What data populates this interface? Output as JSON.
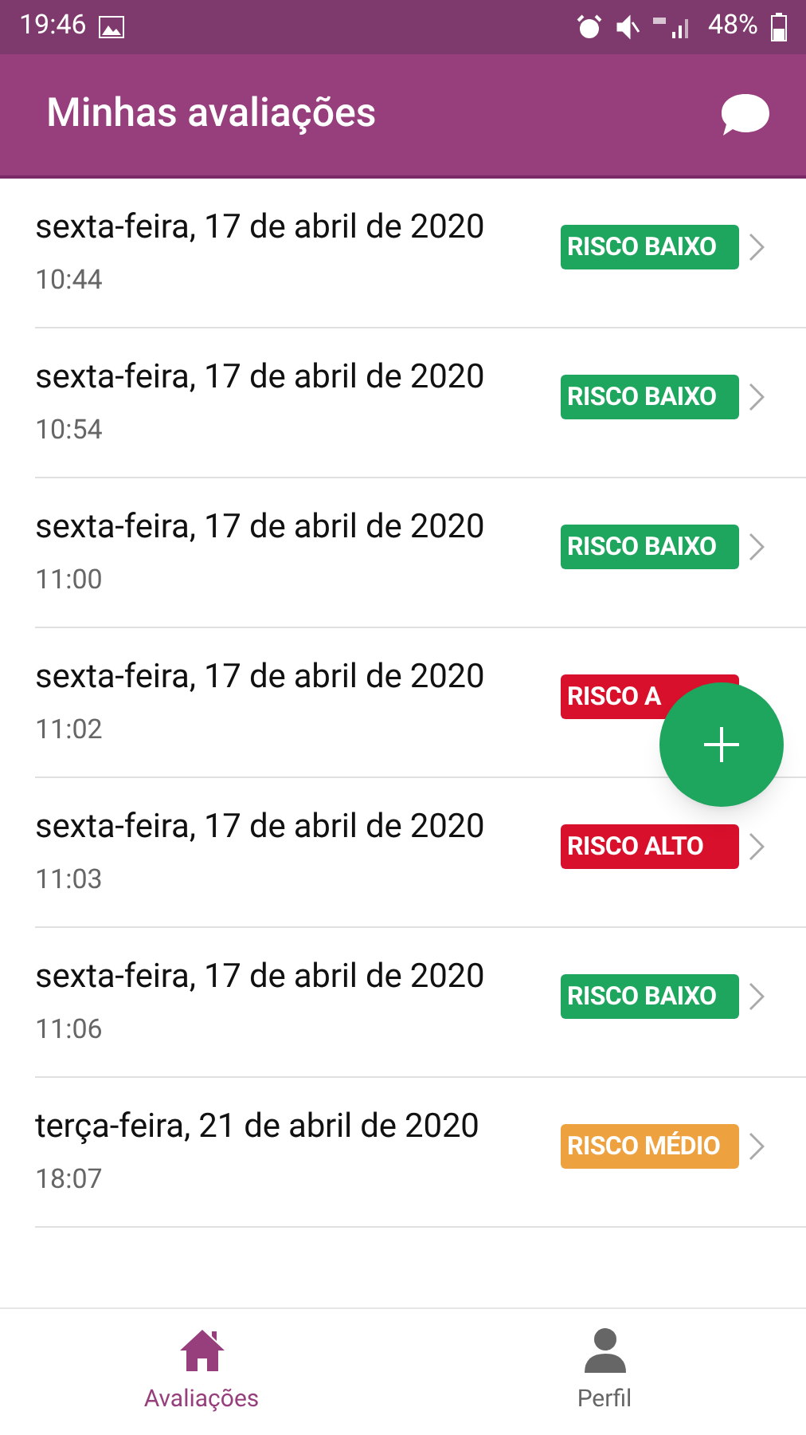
{
  "status_bar": {
    "time": "19:46",
    "battery": "48%"
  },
  "header": {
    "title": "Minhas avaliações"
  },
  "assessments": [
    {
      "date": "sexta-feira, 17 de abril de 2020",
      "time": "10:44",
      "risk": "RISCO BAIXO",
      "color": "#1ea55e",
      "chevron": true
    },
    {
      "date": "sexta-feira, 17 de abril de 2020",
      "time": "10:54",
      "risk": "RISCO BAIXO",
      "color": "#1ea55e",
      "chevron": true
    },
    {
      "date": "sexta-feira, 17 de abril de 2020",
      "time": "11:00",
      "risk": "RISCO BAIXO",
      "color": "#1ea55e",
      "chevron": true
    },
    {
      "date": "sexta-feira, 17 de abril de 2020",
      "time": "11:02",
      "risk": "RISCO A",
      "color": "#d8102c",
      "chevron": false
    },
    {
      "date": "sexta-feira, 17 de abril de 2020",
      "time": "11:03",
      "risk": "RISCO ALTO",
      "color": "#d8102c",
      "chevron": true
    },
    {
      "date": "sexta-feira, 17 de abril de 2020",
      "time": "11:06",
      "risk": "RISCO BAIXO",
      "color": "#1ea55e",
      "chevron": true
    },
    {
      "date": "terça-feira, 21 de abril de 2020",
      "time": "18:07",
      "risk": "RISCO MÉDIO",
      "color": "#eea23f",
      "chevron": true
    }
  ],
  "bottom_nav": [
    {
      "label": "Avaliações",
      "kind": "home",
      "selected": true
    },
    {
      "label": "Perfil",
      "kind": "profile",
      "selected": false
    }
  ]
}
